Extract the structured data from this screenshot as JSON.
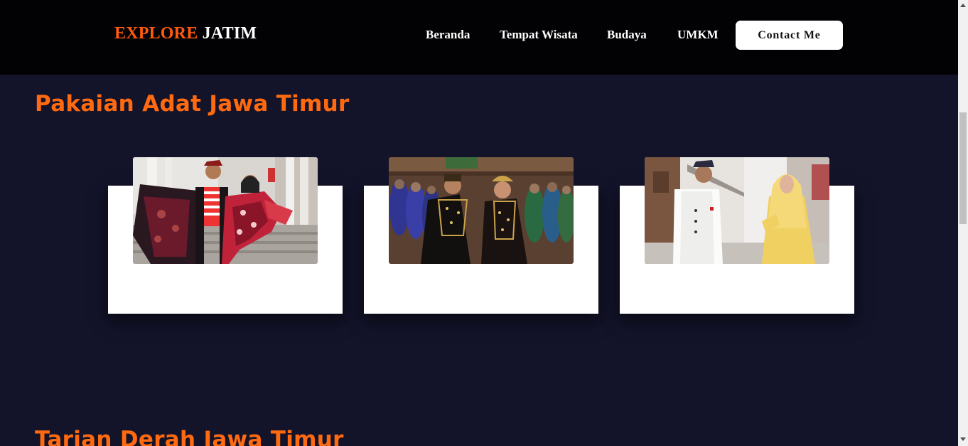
{
  "header": {
    "logo_part1": "EXPLORE",
    "logo_part2": "JATIM",
    "nav": {
      "beranda": "Beranda",
      "tempat_wisata": "Tempat Wisata",
      "budaya": "Budaya",
      "umkm": "UMKM"
    },
    "contact_label": "Contact Me"
  },
  "sections": {
    "pakaian_title": "Pakaian Adat Jawa Timur",
    "tarian_title": "Tarian Derah Jawa Timur"
  },
  "colors": {
    "accent": "#ff6a10",
    "background": "#13132a",
    "navbar": "#020204",
    "card": "#ffffff"
  },
  "icons": {
    "scroll_up": "scroll-up-arrow-icon",
    "scroll_down": "scroll-down-arrow-icon"
  }
}
